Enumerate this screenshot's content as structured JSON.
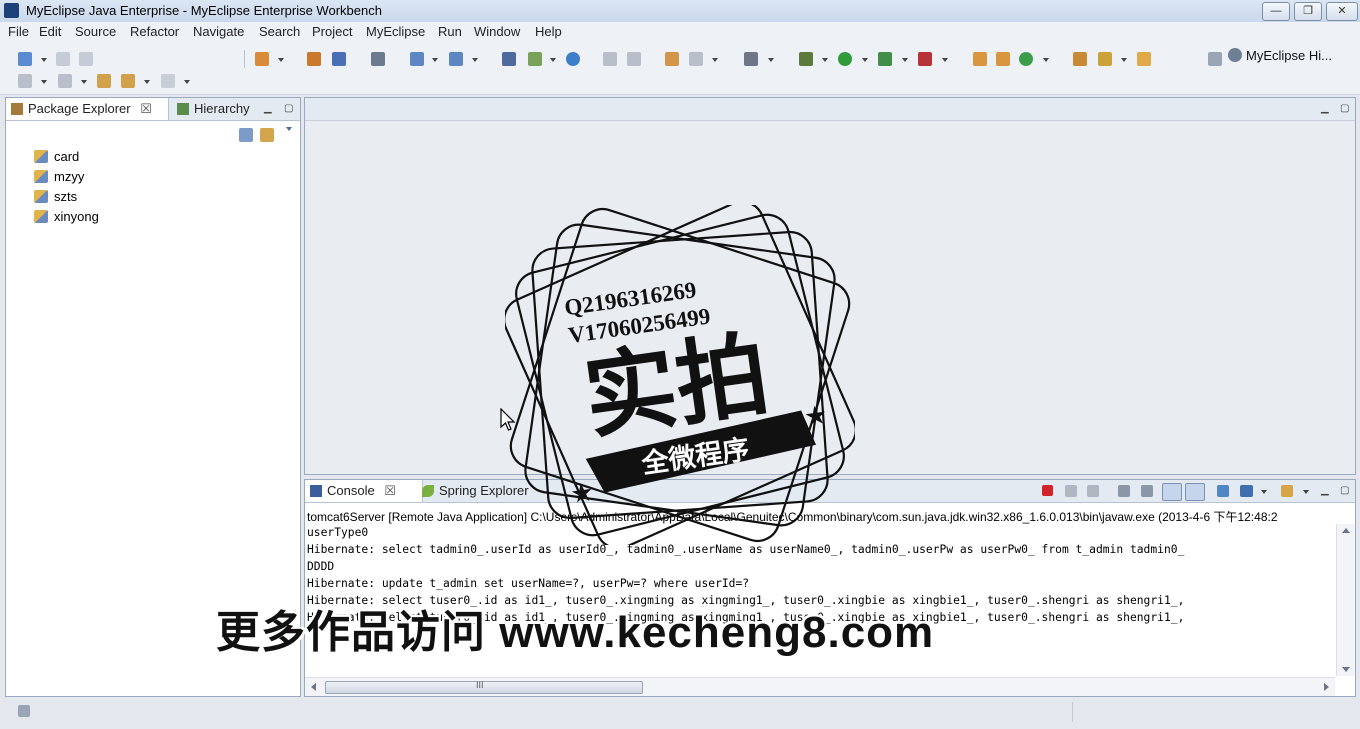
{
  "window": {
    "title": "MyEclipse Java Enterprise - MyEclipse Enterprise Workbench",
    "min_label": "—",
    "max_label": "❐",
    "close_label": "✕"
  },
  "menu": [
    "File",
    "Edit",
    "Source",
    "Refactor",
    "Navigate",
    "Search",
    "Project",
    "MyEclipse",
    "Run",
    "Window",
    "Help"
  ],
  "toolbar": {
    "perspective_label": "MyEclipse Hi..."
  },
  "left_panel": {
    "tabs": [
      {
        "label": "Package Explorer",
        "close": "☒"
      },
      {
        "label": "Hierarchy"
      }
    ],
    "projects": [
      "card",
      "mzyy",
      "szts",
      "xinyong"
    ]
  },
  "console": {
    "tabs": [
      {
        "label": "Console",
        "close": "☒"
      },
      {
        "label": "Spring Explorer"
      }
    ],
    "launch_path": "tomcat6Server [Remote Java Application] C:\\Users\\Administrator\\AppData\\Local\\Genuitec\\Common\\binary\\com.sun.java.jdk.win32.x86_1.6.0.013\\bin\\javaw.exe (2013-4-6 下午12:48:2",
    "lines": [
      "userType0",
      "Hibernate: select tadmin0_.userId as userId0_, tadmin0_.userName as userName0_, tadmin0_.userPw as userPw0_ from t_admin tadmin0_",
      "DDDD",
      "Hibernate: update t_admin set userName=?, userPw=? where userId=?",
      "Hibernate: select tuser0_.id as id1_, tuser0_.xingming as xingming1_, tuser0_.xingbie as xingbie1_, tuser0_.shengri as shengri1_,",
      "Hibernate: select tuser0_.id as id1_, tuser0_.xingming as xingming1_, tuser0_.xingbie as xingbie1_, tuser0_.shengri as shengri1_,"
    ],
    "hscroll_thumb": "III"
  },
  "watermark": {
    "qq": "Q2196316269",
    "wx": "V17060256499",
    "big": "实拍",
    "ribbon": "全微程序",
    "overlay": "更多作品访问 www.kecheng8.com"
  }
}
